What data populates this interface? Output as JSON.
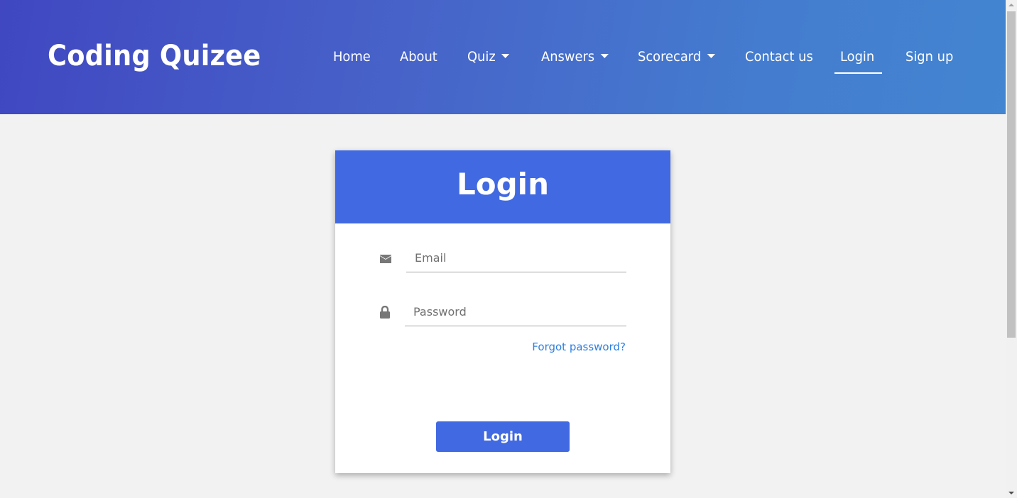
{
  "header": {
    "brand": "Coding Quizee",
    "nav": {
      "home": "Home",
      "about": "About",
      "quiz": "Quiz",
      "answers": "Answers",
      "scorecard": "Scorecard",
      "contact": "Contact us",
      "login": "Login",
      "signup": "Sign up"
    },
    "active_item": "Login"
  },
  "login_card": {
    "title": "Login",
    "email": {
      "placeholder": "Email",
      "value": "",
      "icon": "envelope-icon"
    },
    "password": {
      "placeholder": "Password",
      "value": "",
      "icon": "lock-icon"
    },
    "forgot_link": "Forgot password?",
    "submit_label": "Login"
  },
  "colors": {
    "header_gradient_start": "#4047c1",
    "header_gradient_end": "#4385d0",
    "accent": "#4169e1",
    "link": "#2f7fe0",
    "page_background": "#f2f2f2"
  }
}
